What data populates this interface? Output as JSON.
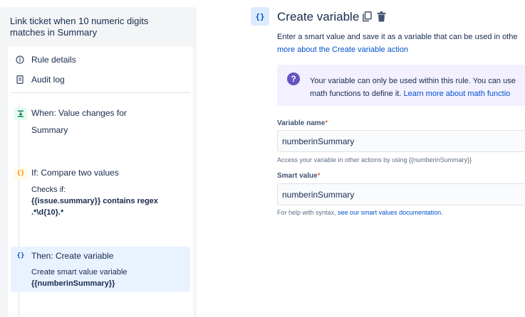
{
  "rule": {
    "title": "Link ticket when 10 numeric digits matches in Summary"
  },
  "nav": {
    "rule_details": "Rule details",
    "audit_log": "Audit log"
  },
  "steps": [
    {
      "badge": "⇣",
      "title": "When: Value changes for",
      "desc": "Summary"
    },
    {
      "badge": "{}",
      "title": "If: Compare two values",
      "desc_prefix": "Checks if:",
      "desc_bold": "{{issue.summary}} contains regex .*\\d{10}.*"
    },
    {
      "badge": "{}",
      "title": "Then: Create variable",
      "desc_prefix": "Create smart value variable",
      "desc_bold": "{{numberinSummary}}"
    }
  ],
  "panel": {
    "badge": "{}",
    "title": "Create variable",
    "intro_text": "Enter a smart value and save it as a variable that can be used in othe",
    "intro_link": "more about the Create variable action",
    "info_line1": "Your variable can only be used within this rule. You can use",
    "info_line2_prefix": "math functions to define it. ",
    "info_line2_link": "Learn more about math functio",
    "variable_name_label": "Variable name",
    "variable_name_value": "numberinSummary",
    "variable_name_help": "Access your variable in other actions by using {{numberinSummary}}",
    "smart_value_label": "Smart value",
    "smart_value_value": "numberinSummary",
    "smart_value_help_prefix": "For help with syntax, ",
    "smart_value_help_link": "see our smart values documentation",
    "smart_value_help_suffix": ".",
    "required_mark": "*"
  },
  "colors": {
    "trigger_badge_bg": "#e3fcef",
    "trigger_badge_fg": "#006644",
    "condition_badge_bg": "#fffae6",
    "condition_badge_fg": "#ff8b00",
    "action_badge_fg": "#0052cc",
    "accent": "#0052cc",
    "info_bg": "#f3f0ff",
    "info_icon": "#6554c0"
  }
}
